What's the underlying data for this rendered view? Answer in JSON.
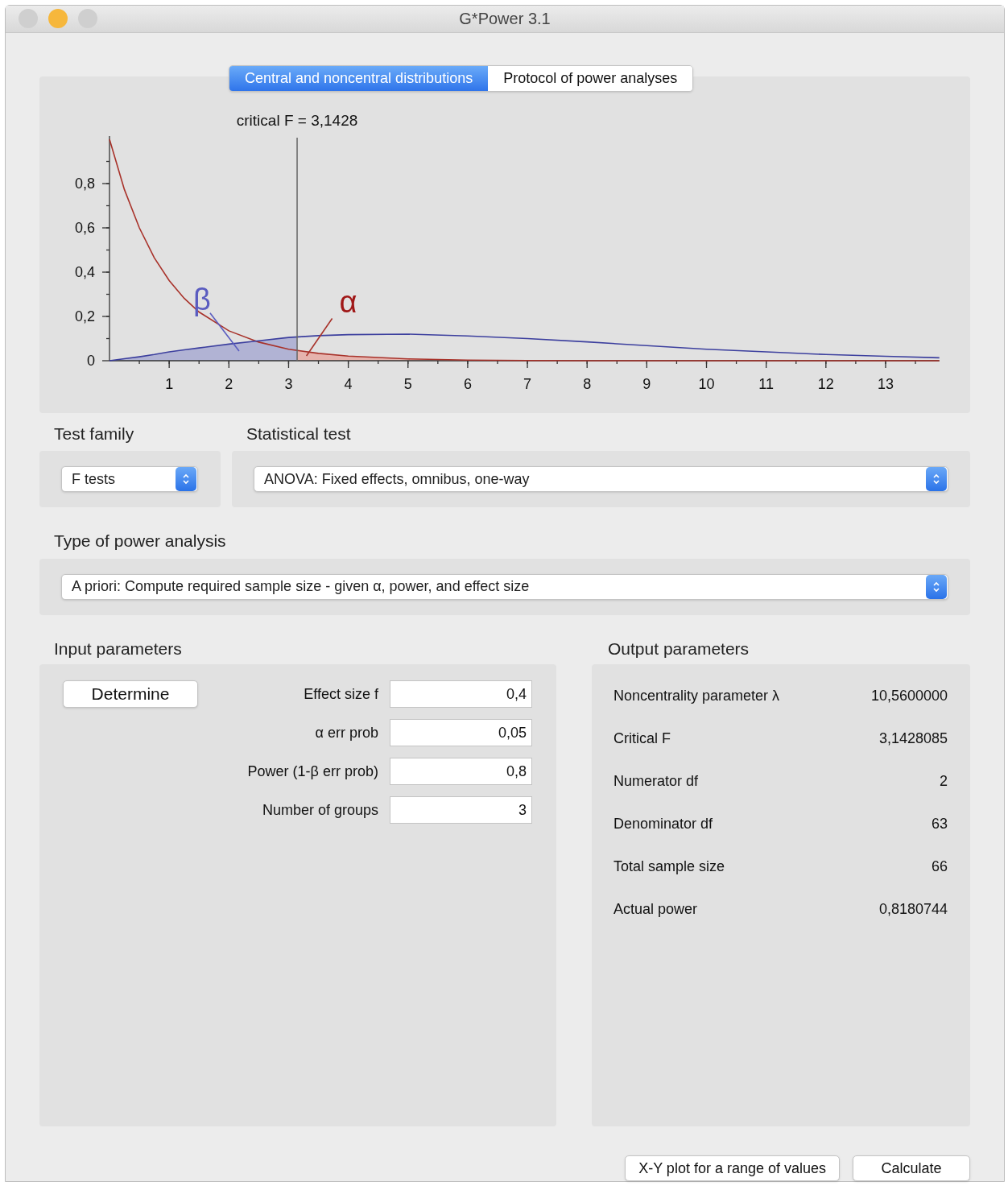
{
  "window": {
    "title": "G*Power 3.1",
    "controls": [
      {
        "color": "#cfcfcf"
      },
      {
        "color": "#f6b73c"
      },
      {
        "color": "#cfcfcf"
      }
    ]
  },
  "tabs": [
    {
      "label": "Central and noncentral distributions",
      "selected": true
    },
    {
      "label": "Protocol of power analyses",
      "selected": false
    }
  ],
  "distribution_plot": {
    "critical_label": "critical F = 3,1428",
    "beta_label": "β",
    "alpha_label": "α",
    "chart_data": {
      "type": "line",
      "x": [
        0,
        0.25,
        0.5,
        0.75,
        1,
        1.25,
        1.5,
        2,
        2.5,
        3,
        3.5,
        4,
        5,
        6,
        7,
        8,
        9,
        10,
        11,
        12,
        13,
        13.9
      ],
      "series": [
        {
          "color": "#a8322a",
          "values": [
            1,
            0.773,
            0.6,
            0.465,
            0.362,
            0.282,
            0.22,
            0.135,
            0.084,
            0.052,
            0.033,
            0.021,
            0.008,
            0.003,
            0.001,
            0,
            0,
            0,
            0,
            0,
            0,
            0
          ]
        },
        {
          "color": "#3c3f9e",
          "values": [
            0,
            0.009,
            0.018,
            0.028,
            0.04,
            0.049,
            0.058,
            0.075,
            0.09,
            0.105,
            0.113,
            0.118,
            0.12,
            0.112,
            0.1,
            0.085,
            0.068,
            0.052,
            0.04,
            0.028,
            0.02,
            0.013
          ]
        }
      ],
      "xlim": [
        0,
        13.9
      ],
      "ylim": [
        0,
        1
      ],
      "xticks": [
        1,
        2,
        3,
        4,
        5,
        6,
        7,
        8,
        9,
        10,
        11,
        12,
        13
      ],
      "yticks": [
        {
          "value": 0,
          "label": "0"
        },
        {
          "value": 0.2,
          "label": "0,2"
        },
        {
          "value": 0.4,
          "label": "0,4"
        },
        {
          "value": 0.6,
          "label": "0,6"
        },
        {
          "value": 0.8,
          "label": "0,8"
        }
      ],
      "ref_lines": [
        {
          "axis": "x",
          "value": 3.1428
        }
      ]
    }
  },
  "test_family": {
    "label": "Test family",
    "value": "F tests"
  },
  "statistical_test": {
    "label": "Statistical test",
    "value": "ANOVA: Fixed effects, omnibus, one-way"
  },
  "power_analysis_type": {
    "label": "Type of power analysis",
    "value": "A priori: Compute required sample size - given α, power, and effect size"
  },
  "input_parameters": {
    "title": "Input parameters",
    "determine_button": "Determine",
    "fields": [
      {
        "label": "Effect size f",
        "value": "0,4"
      },
      {
        "label": "α err prob",
        "value": "0,05"
      },
      {
        "label": "Power (1-β err prob)",
        "value": "0,8"
      },
      {
        "label": "Number of groups",
        "value": "3"
      }
    ]
  },
  "output_parameters": {
    "title": "Output parameters",
    "rows": [
      {
        "label": "Noncentrality parameter λ",
        "value": "10,5600000"
      },
      {
        "label": "Critical F",
        "value": "3,1428085"
      },
      {
        "label": "Numerator df",
        "value": "2"
      },
      {
        "label": "Denominator df",
        "value": "63"
      },
      {
        "label": "Total sample size",
        "value": "66"
      },
      {
        "label": "Actual power",
        "value": "0,8180744"
      }
    ]
  },
  "buttons": [
    "X-Y plot for a range of values",
    "Calculate"
  ]
}
